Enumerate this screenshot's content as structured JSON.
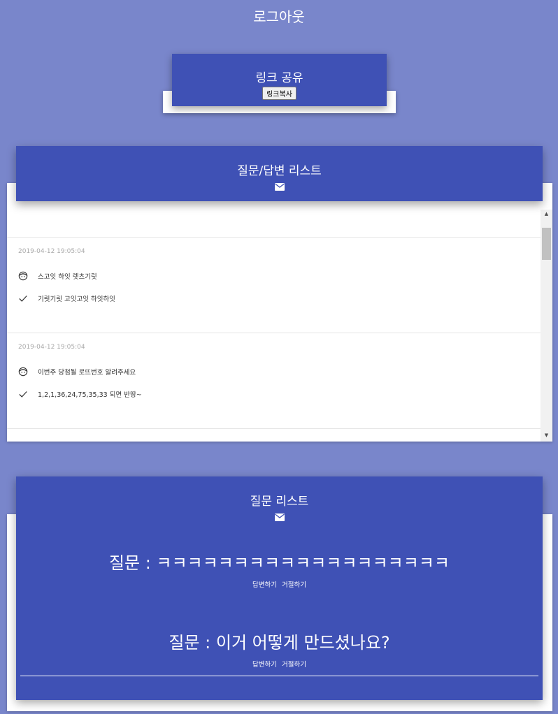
{
  "header": {
    "logout_label": "로그아웃"
  },
  "share": {
    "title": "링크 공유",
    "copy_button": "링크복사"
  },
  "qa_list": {
    "title": "질문/답변 리스트",
    "items": [
      {
        "date": "2019-04-12 19:05:04",
        "question": "스고잇 하잇 렛츠기릿",
        "answer": "기릿기릿 고잇고잇 하잇하잇"
      },
      {
        "date": "2019-04-12 19:05:04",
        "question": "이번주 당첨될 로뜨번호 알려주세요",
        "answer": "1,2,1,36,24,75,35,33 되면 반땅~"
      }
    ]
  },
  "question_list": {
    "title": "질문 리스트",
    "items": [
      {
        "prefix": "질문 : ",
        "text": "ㅋㅋㅋㅋㅋㅋㅋㅋㅋㅋㅋㅋㅋㅋㅋㅋㅋㅋㅋ",
        "answer_label": "답변하기",
        "reject_label": "거절하기"
      },
      {
        "prefix": "질문 : ",
        "text": "이거 어떻게 만드셨나요?",
        "answer_label": "답변하기",
        "reject_label": "거절하기"
      }
    ]
  },
  "icons": {
    "mail": "mail-icon",
    "user": "user-face-icon",
    "check": "check-icon"
  },
  "colors": {
    "background": "#7986cb",
    "primary": "#3f51b5",
    "surface": "#ffffff"
  }
}
